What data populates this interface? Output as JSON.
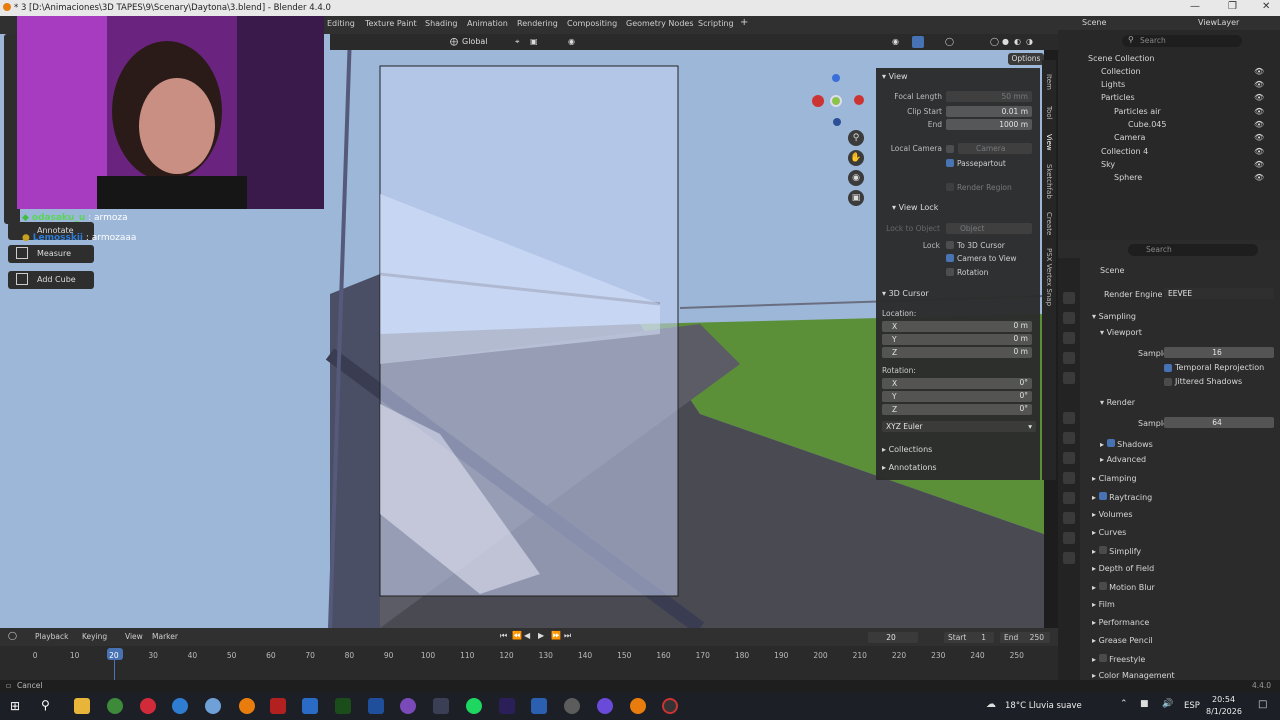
{
  "window": {
    "title": "* 3 [D:\\Animaciones\\3D TAPES\\9\\Scenary\\Daytona\\3.blend] - Blender 4.4.0"
  },
  "workspaces": [
    "Editing",
    "Texture Paint",
    "Shading",
    "Animation",
    "Rendering",
    "Compositing",
    "Geometry Nodes",
    "Scripting"
  ],
  "scene_selector": {
    "name": "Scene",
    "view_layer": "ViewLayer"
  },
  "viewport_header": {
    "orientation": "Global",
    "options_label": "Options"
  },
  "tools": {
    "annotate": "Annotate",
    "measure": "Measure",
    "add_cube": "Add Cube"
  },
  "chat": [
    {
      "user": "odasaku_u",
      "message": "armoza"
    },
    {
      "user": "Lemosskii",
      "message": "armozaaa"
    }
  ],
  "npanel": {
    "tabs": [
      "Item",
      "Tool",
      "View",
      "Sketchfab",
      "Create",
      "PSX Vertex Snap"
    ],
    "view": {
      "title": "View",
      "focal_length_label": "Focal Length",
      "focal_length": "50 mm",
      "clip_start_label": "Clip Start",
      "clip_start": "0.01 m",
      "end_label": "End",
      "end": "1000 m",
      "local_camera_label": "Local Camera",
      "local_camera_value": "Camera",
      "passepartout": "Passepartout",
      "render_region": "Render Region"
    },
    "view_lock": {
      "title": "View Lock",
      "lock_to_object_label": "Lock to Object",
      "lock_to_object_value": "Object",
      "lock_label": "Lock",
      "to_3d_cursor": "To 3D Cursor",
      "camera_to_view": "Camera to View",
      "rotation": "Rotation"
    },
    "cursor": {
      "title": "3D Cursor",
      "location_label": "Location:",
      "x_label": "X",
      "y_label": "Y",
      "z_label": "Z",
      "loc_x": "0 m",
      "loc_y": "0 m",
      "loc_z": "0 m",
      "rotation_label": "Rotation:",
      "rot_x": "0°",
      "rot_y": "0°",
      "rot_z": "0°",
      "mode": "XYZ Euler"
    },
    "collections": "Collections",
    "annotations": "Annotations"
  },
  "outliner": {
    "search_placeholder": "Search",
    "items": [
      "Scene Collection",
      "Collection",
      "Lights",
      "Particles",
      "Particles air",
      "Cube.045",
      "Camera",
      "Collection 4",
      "Sky",
      "Sphere"
    ]
  },
  "properties": {
    "search_placeholder": "Search",
    "scene": "Scene",
    "render_engine_label": "Render Engine",
    "render_engine": "EEVEE",
    "sampling": "Sampling",
    "viewport": "Viewport",
    "samples_label": "Samples",
    "viewport_samples": "16",
    "temporal_reprojection": "Temporal Reprojection",
    "jittered_shadows": "Jittered Shadows",
    "render": "Render",
    "render_samples": "64",
    "shadows": "Shadows",
    "advanced": "Advanced",
    "panels": [
      "Clamping",
      "Raytracing",
      "Volumes",
      "Curves",
      "Simplify",
      "Depth of Field",
      "Motion Blur",
      "Film",
      "Performance",
      "Grease Pencil",
      "Freestyle",
      "Color Management"
    ]
  },
  "timeline": {
    "menus": [
      "Playback",
      "Keying",
      "View",
      "Marker"
    ],
    "current_frame": "20",
    "start_label": "Start",
    "start": "1",
    "end_label": "End",
    "end": "250",
    "ticks": [
      "0",
      "10",
      "20",
      "30",
      "40",
      "50",
      "60",
      "70",
      "80",
      "90",
      "100",
      "110",
      "120",
      "130",
      "140",
      "150",
      "160",
      "170",
      "180",
      "190",
      "200",
      "210",
      "220",
      "230",
      "240",
      "250"
    ]
  },
  "status": {
    "left": "Cancel",
    "version": "4.4.0"
  },
  "taskbar": {
    "weather": "18°C Lluvia suave",
    "language": "ESP",
    "time": "20:54",
    "date": "8/1/2026"
  }
}
